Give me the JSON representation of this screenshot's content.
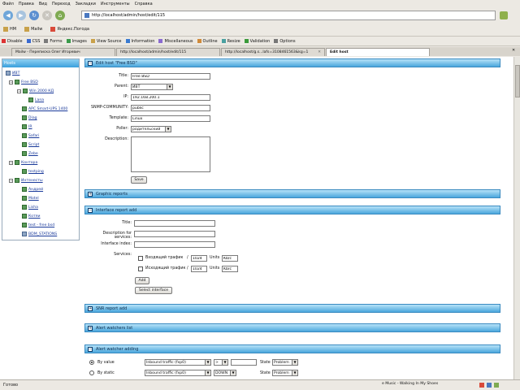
{
  "menu": [
    "Файл",
    "Правка",
    "Вид",
    "Переход",
    "Закладки",
    "Инструменты",
    "Справка"
  ],
  "address": {
    "url": "http://localhost/admin/host/edit/115"
  },
  "bookmarks": [
    "HM",
    "Mailw",
    "Яндекс.Погода"
  ],
  "toolbar": [
    "Disable",
    "CSS",
    "Forms",
    "Images",
    "View Source",
    "Information",
    "Miscellaneous",
    "Outline",
    "Resize",
    "Validation",
    "Options"
  ],
  "tabs": [
    {
      "label": "Mailw - Переписка Олег Игоревич"
    },
    {
      "label": "http://localhost/admin/host/edit/115"
    },
    {
      "label": "http://localhost/g.s...lafs=3108461563&kg=1"
    },
    {
      "label": "Edit host",
      "active": true
    }
  ],
  "sidebar": {
    "title": "Hosts",
    "nodes": [
      {
        "label": "ИВТ"
      },
      {
        "label": "Free BSD"
      },
      {
        "label": "Win 2000 КД"
      },
      {
        "label": "Lana"
      },
      {
        "label": "APC Smart-UPS 1400"
      },
      {
        "label": "Diag"
      },
      {
        "label": "IR"
      },
      {
        "label": "Safari"
      },
      {
        "label": "Script"
      },
      {
        "label": "Zebe"
      },
      {
        "label": "Контора"
      },
      {
        "label": "testping"
      },
      {
        "label": "Интенесты"
      },
      {
        "label": "Андрей"
      },
      {
        "label": "Motel"
      },
      {
        "label": "Lisha"
      },
      {
        "label": "Котяи"
      },
      {
        "label": "test - free bsd"
      },
      {
        "label": "BDM_STATIONS"
      }
    ]
  },
  "edit_host": {
    "header": "Edit host \"Free BSD\"",
    "title_label": "Title:",
    "title_value": "Free BSD",
    "parent_label": "Parent:",
    "parent_value": "ИВТ",
    "ip_label": "IP:",
    "ip_value": "192.168.200.1",
    "snmp_label": "SNMP-COMMUNITY:",
    "snmp_value": "public",
    "template_label": "Template:",
    "template_value": "Linux",
    "poller_label": "Poller:",
    "poller_value": "родительский",
    "description_label": "Description:",
    "save_label": "Save"
  },
  "graphic_reports": {
    "header": "Graphic reports"
  },
  "interface_report": {
    "header": "Interface report add",
    "title_label": "Title:",
    "desc_label": "Description for services:",
    "index_label": "Interface index:",
    "services_label": "Services:",
    "in_traffic_label": "Входящий трафик",
    "out_traffic_label": "Исходящий трафик",
    "slash": "/",
    "divisor": "1024",
    "units_label": "Units",
    "units_value": "Kb/c",
    "add_label": "Add",
    "select_label": "Select interface"
  },
  "snr_report": {
    "header": "SNR report add"
  },
  "alert_list": {
    "header": "Alert watchers list"
  },
  "alert_add": {
    "header": "Alert watcher adding",
    "rows": [
      {
        "mode": "By value",
        "metric": "Inbound traffic (fxp0)",
        "op": ">",
        "state_label": "State",
        "state": "Problem"
      },
      {
        "mode": "By static",
        "metric": "Inbound traffic (fxp0)",
        "op": "DOWN",
        "state_label": "State",
        "state": "Problem"
      }
    ]
  },
  "status": {
    "text": "Готово",
    "music": "e Music - Walking In My Shoes"
  },
  "colors": {
    "section_top": "#b6e2f8",
    "section_bottom": "#4aa6dc",
    "link": "#1a3a9a"
  }
}
